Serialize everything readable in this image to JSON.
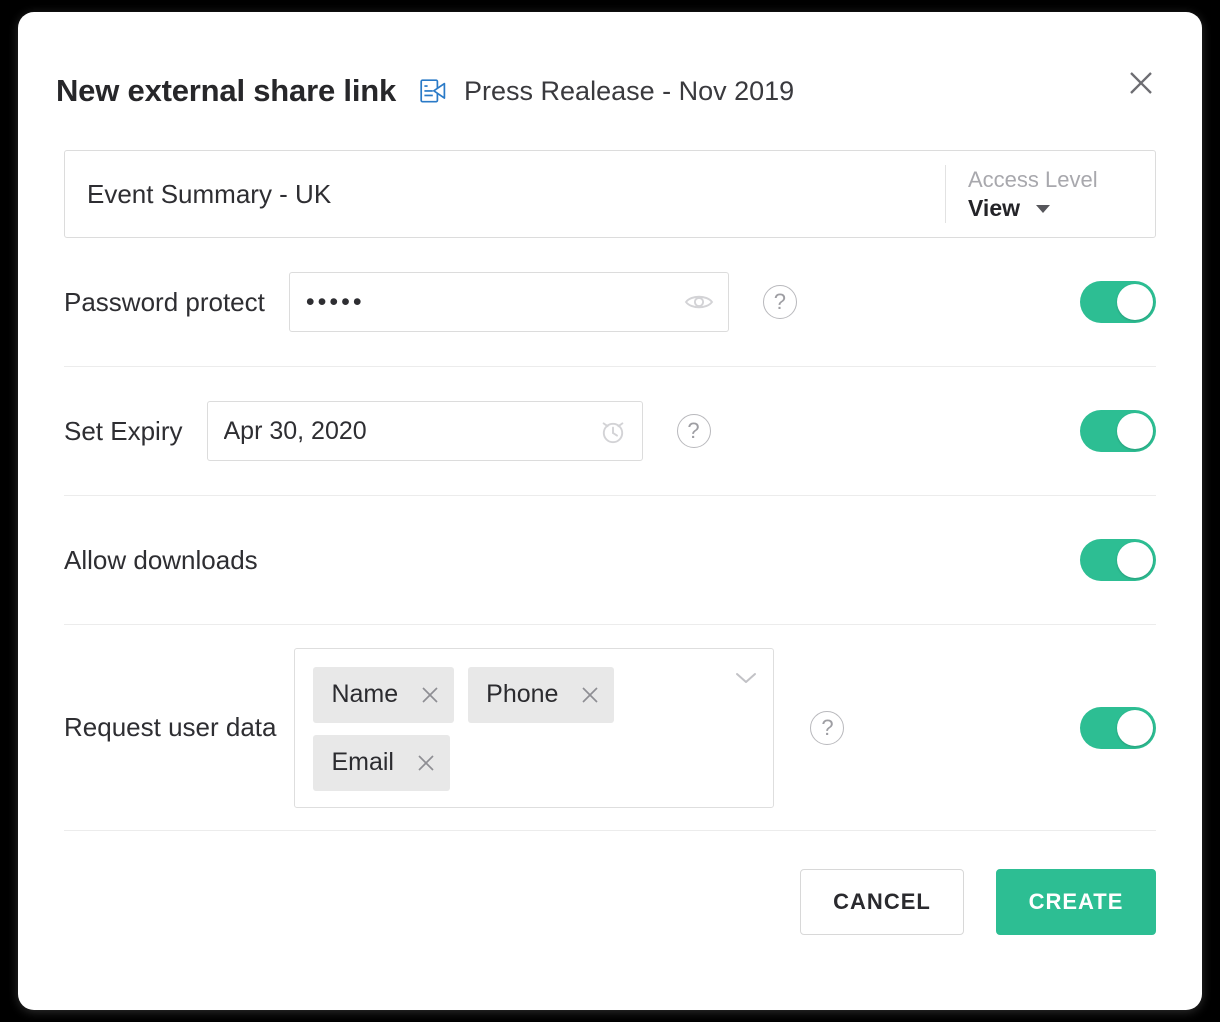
{
  "dialog": {
    "title": "New external share link",
    "document_name": "Press Realease - Nov 2019",
    "document_icon": "document-share-icon",
    "close_icon": "close-icon",
    "accent_color": "#2dbe93",
    "doc_icon_color": "#2a7ac7"
  },
  "link": {
    "name_value": "Event Summary - UK",
    "name_placeholder": "Link name",
    "access_level_label": "Access Level",
    "access_level_value": "View",
    "access_level_caret_icon": "chevron-down-icon"
  },
  "options": {
    "password": {
      "label": "Password protect",
      "value": "•••••",
      "placeholder": "Password",
      "reveal_icon": "eye-icon",
      "help_icon": "question-mark-icon",
      "help_label": "?",
      "enabled": true
    },
    "expiry": {
      "label": "Set Expiry",
      "value": "Apr 30, 2020",
      "placeholder": "Select date",
      "date_icon": "alarm-clock-icon",
      "help_icon": "question-mark-icon",
      "help_label": "?",
      "enabled": true
    },
    "downloads": {
      "label": "Allow downloads",
      "enabled": true
    },
    "userdata": {
      "label": "Request user data",
      "chips": [
        {
          "label": "Name",
          "remove_icon": "close-icon"
        },
        {
          "label": "Phone",
          "remove_icon": "close-icon"
        },
        {
          "label": "Email",
          "remove_icon": "close-icon"
        }
      ],
      "expand_icon": "chevron-down-icon",
      "help_icon": "question-mark-icon",
      "help_label": "?",
      "enabled": true
    }
  },
  "footer": {
    "cancel_label": "CANCEL",
    "create_label": "CREATE"
  }
}
